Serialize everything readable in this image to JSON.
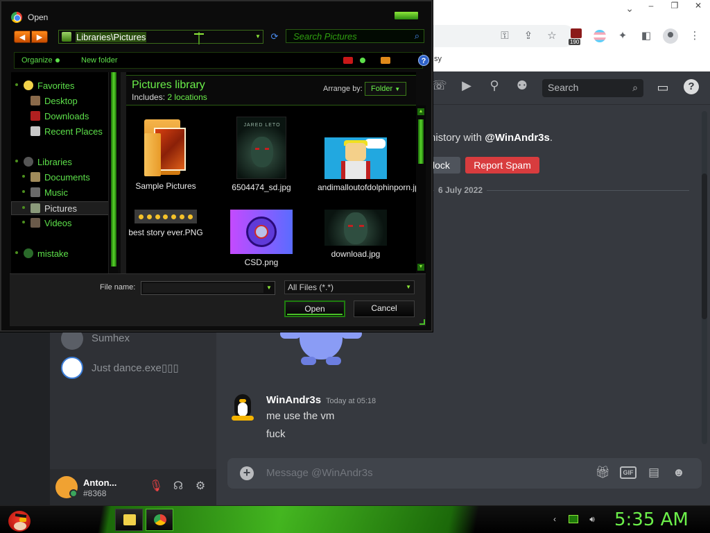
{
  "chrome": {
    "window_controls": [
      "–",
      "❐",
      "✕"
    ],
    "infobar_text": "sy",
    "extension_badge": "190"
  },
  "discord": {
    "search_placeholder": "Search",
    "history_prefix": "history with ",
    "history_user": "@WinAndr3s",
    "history_suffix": ".",
    "block_label": "lock",
    "report_spam_label": "Report Spam",
    "date_divider": "6 July 2022",
    "dm_list": [
      {
        "name": "Sumhex"
      },
      {
        "name": "Just dance.exe▯▯▯"
      }
    ],
    "message": {
      "author": "WinAndr3s",
      "time": "Today at 05:18",
      "lines": [
        "me use the vm",
        "fuck"
      ]
    },
    "composer_placeholder": "Message @WinAndr3s",
    "gif_label": "GIF",
    "user": {
      "name": "Anton...",
      "tag": "#8368"
    }
  },
  "dialog": {
    "title": "Open",
    "address": "Libraries\\Pictures",
    "search_placeholder": "Search Pictures",
    "commands": {
      "organize": "Organize",
      "new_folder": "New folder"
    },
    "help": "?",
    "nav": {
      "favorites": "Favorites",
      "desktop": "Desktop",
      "downloads": "Downloads",
      "recent_places": "Recent Places",
      "libraries": "Libraries",
      "documents": "Documents",
      "music": "Music",
      "pictures": "Pictures",
      "videos": "Videos",
      "mistake": "mistake"
    },
    "library": {
      "title": "Pictures library",
      "includes_label": "Includes:",
      "includes_link": "2 locations",
      "arrange_label": "Arrange by:",
      "arrange_value": "Folder"
    },
    "files": [
      {
        "name": "Sample Pictures"
      },
      {
        "name": "6504474_sd.jpg",
        "poster_text": "JARED LETO"
      },
      {
        "name": "andimalloutofdolphinporn.jpg"
      },
      {
        "name": "best story ever.PNG"
      },
      {
        "name": "CSD.png"
      },
      {
        "name": "download.jpg"
      }
    ],
    "file_name_label": "File name:",
    "file_name_value": "",
    "file_type": "All Files (*.*)",
    "open_label": "Open",
    "cancel_label": "Cancel"
  },
  "taskbar": {
    "clock": "5:35 AM"
  }
}
